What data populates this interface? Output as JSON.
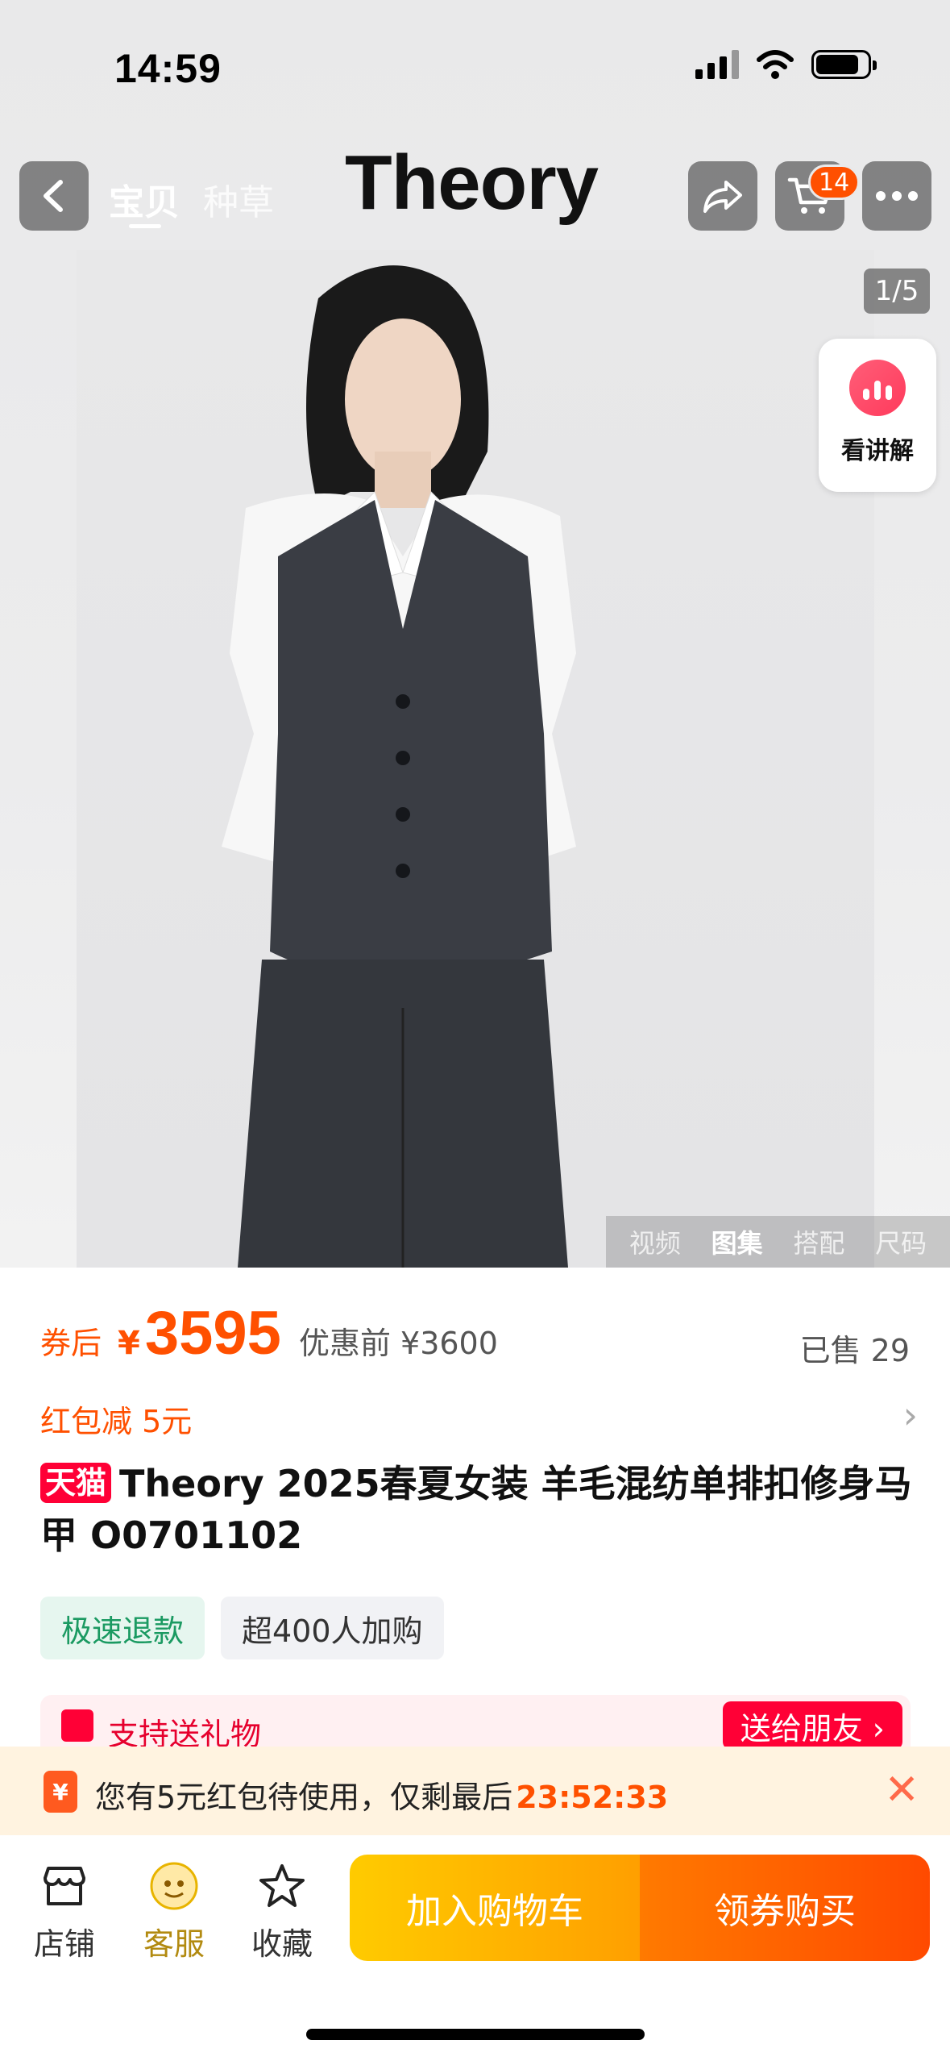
{
  "status": {
    "time": "14:59"
  },
  "nav": {
    "tab_bao": "宝贝",
    "tab_zhong": "种草",
    "brand": "Theory",
    "cart_count": "14"
  },
  "hero": {
    "counter": "1/5",
    "explain_label": "看讲解",
    "media_tabs": [
      "视频",
      "图集",
      "搭配",
      "尺码"
    ]
  },
  "price": {
    "prefix": "券后",
    "symbol": "¥",
    "value": "3595",
    "before": "优惠前 ¥3600",
    "sold": "已售 29"
  },
  "promo": {
    "red_packet": "红包减 5元"
  },
  "product": {
    "platform_badge": "天猫",
    "title": "Theory 2025春夏女装 羊毛混纺单排扣修身马甲 O0701102"
  },
  "tags": {
    "refund": "极速退款",
    "buyers": "超400人加购"
  },
  "gift": {
    "label": "支持送礼物",
    "button": "送给朋友 ›"
  },
  "coupon": {
    "icon": "¥",
    "text": "您有5元红包待使用，仅剩最后",
    "timer": "23:52:33"
  },
  "bottom": {
    "store": "店铺",
    "service": "客服",
    "favorite": "收藏",
    "add_to_cart": "加入购物车",
    "buy": "领券购买"
  },
  "colors": {
    "accent": "#ff5000",
    "tmall": "#ff0036",
    "refund_green": "#1b9a62"
  },
  "icons": [
    "back-icon",
    "share-icon",
    "cart-icon",
    "more-icon",
    "explain-icon",
    "gift-icon",
    "coupon-icon",
    "close-icon",
    "store-icon",
    "service-icon",
    "star-icon"
  ]
}
